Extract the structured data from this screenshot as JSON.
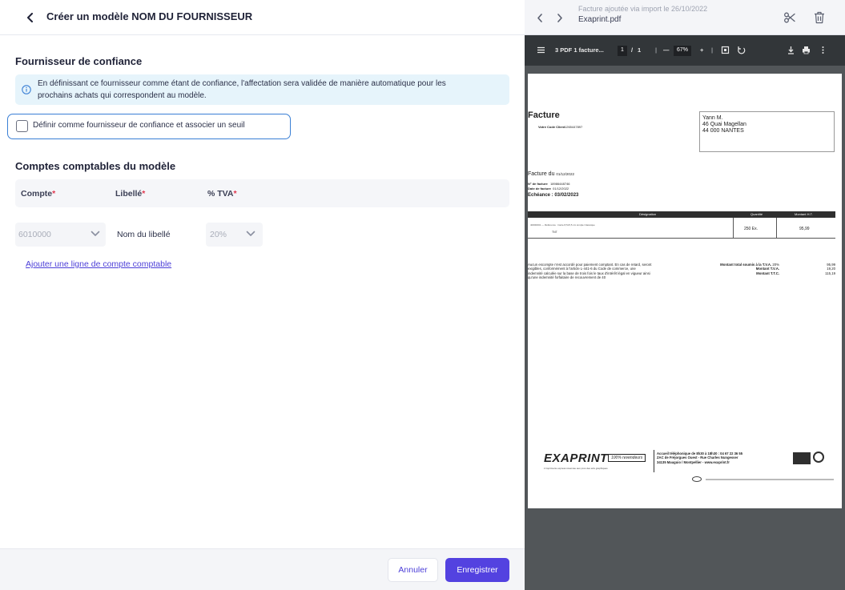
{
  "header": {
    "back_label": "<",
    "title": "Créer un modèle NOM DU FOURNISSEUR"
  },
  "trusted": {
    "title": "Fournisseur de confiance",
    "info_line1": "En définissant ce fournisseur comme étant de confiance, l'affectation sera validée de manière automatique pour les",
    "info_line2": "prochains achats qui correspondent au modèle.",
    "checkbox_label": "Définir comme fournisseur de confiance et associer un seuil",
    "checkbox_checked": false
  },
  "accounts": {
    "title": "Comptes comptables du modèle",
    "columns": [
      {
        "label": "Compte",
        "required": "*"
      },
      {
        "label": "Libellé",
        "required": "*"
      },
      {
        "label": "% TVA",
        "required": "*"
      }
    ],
    "row": {
      "compte": "6010000",
      "libelle": "Nom du libellé",
      "tva": "20%"
    },
    "add_link": "Ajouter une ligne de compte comptable"
  },
  "footer": {
    "cancel": "Annuler",
    "save": "Enregistrer"
  },
  "viewer": {
    "imported_text": "Facture ajoutée via import le 26/10/2022",
    "filename": "Exaprint.pdf",
    "pdf_title": "3 PDF 1 facture...",
    "page_current": "1",
    "page_sep": "/",
    "page_total": "1",
    "zoom": "67%",
    "minus": "—",
    "plus": "+"
  },
  "invoice": {
    "title": "Facture",
    "client_code_label": "Votre Code Client",
    "client_code": "1265447897",
    "addr1": "Yann M.",
    "addr2": "46 Quai Magellan",
    "addr3": "44 000 NANTES",
    "date_label": "Facture du",
    "date": "01/12/2022",
    "num_label": "N° de facture",
    "num": "18986448746",
    "date2_label": "Date de facture",
    "date2": "01/12/2022",
    "due": "Echéance : 03/02/2023",
    "col_designation": "Désignation",
    "col_qty": "Quantité",
    "col_amount": "Montant H.T.",
    "line_ref": "40000001 — Référence : Carte 8,5x5,5 cm simple Classique",
    "line_transport": "TNT",
    "line_qty": "250 Ex.",
    "line_amount": "95,99",
    "legal1": "Aucun escompte n'est accordé pour paiement comptant. En cas de retard, seront",
    "legal2": "exigibles, conformément à l'article L-441-6 du Code de commerce, une",
    "legal3": "indemnité calculée sur la base de trois fois le taux d'intérêt légal en vigueur ainsi",
    "legal4": "qu'une indemnité forfaitaire de recouvrement de 40",
    "total_ht_label": "Montant total soumis à la T.V.A.",
    "tva_rate": "20%",
    "total_ht": "95,99",
    "tva_label": "Montant T.V.A.",
    "tva": "19,20",
    "ttc_label": "Montant T.T.C.",
    "ttc": "115,19",
    "brand": "EXAPRINT",
    "brand_tag": "100% revendeurs",
    "brand_sub": "L'imprimerie express réservée aux pros des arts graphiques",
    "contact1": "Accueil téléphonique de 8h30 à 18h30 : 04 67 22 36 55",
    "contact2": "ZAC de Fréjorgues Ouest - Rue Charles Nungesser",
    "contact3": "34135 Mauguio / Montpellier - www.exaprint.fr"
  }
}
